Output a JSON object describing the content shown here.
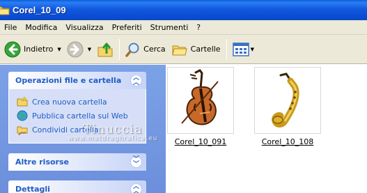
{
  "window": {
    "title": "Corel_10_09"
  },
  "menu": [
    "File",
    "Modifica",
    "Visualizza",
    "Preferiti",
    "Strumenti",
    "?"
  ],
  "toolbar": {
    "back_label": "Indietro",
    "search_label": "Cerca",
    "folders_label": "Cartelle"
  },
  "sidebar": {
    "file_tasks": {
      "title": "Operazioni file e cartella",
      "items": [
        {
          "label": "Crea nuova cartella",
          "icon": "new-folder-icon"
        },
        {
          "label": "Pubblica cartella sul Web",
          "icon": "publish-web-icon"
        },
        {
          "label": "Condividi cartella",
          "icon": "share-folder-icon"
        }
      ]
    },
    "other_places": {
      "title": "Altre risorse"
    },
    "details": {
      "title": "Dettagli"
    }
  },
  "files": [
    {
      "name": "Corel_10_091",
      "icon": "violin-icon"
    },
    {
      "name": "Corel_10_108",
      "icon": "saxophone-icon"
    }
  ],
  "watermark": {
    "line1": "Tinuccia",
    "line2": "www.matdraghrafica.eu"
  },
  "colors": {
    "titlebar": "#0b4fd6",
    "panel_text": "#215dc6",
    "sidebar_bg": "#7ba2e7"
  }
}
